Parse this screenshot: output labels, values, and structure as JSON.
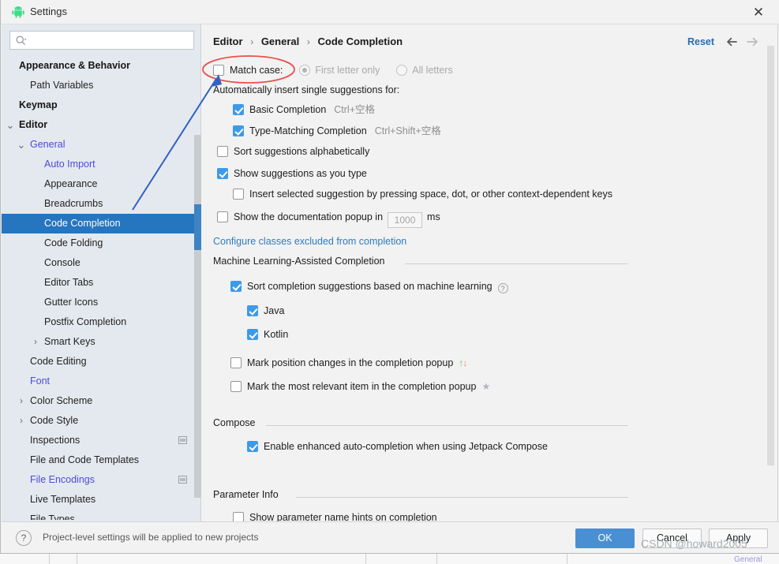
{
  "window": {
    "title": "Settings",
    "app_icon": "android-robot-icon",
    "close_label": "✕"
  },
  "sidebar": {
    "search": {
      "placeholder": "",
      "value": "",
      "icon": "search-icon"
    },
    "items": [
      {
        "label": "Appearance & Behavior",
        "indent": 0,
        "style": "bold",
        "arrow": "",
        "badge": false
      },
      {
        "label": "Path Variables",
        "indent": 14,
        "style": "plain",
        "arrow": "",
        "badge": false
      },
      {
        "label": "Keymap",
        "indent": 0,
        "style": "bold",
        "arrow": "",
        "badge": false
      },
      {
        "label": "Editor",
        "indent": 0,
        "style": "bold",
        "arrow": "down",
        "badge": false
      },
      {
        "label": "General",
        "indent": 14,
        "style": "link",
        "arrow": "down",
        "badge": false
      },
      {
        "label": "Auto Import",
        "indent": 32,
        "style": "link",
        "arrow": "",
        "badge": false
      },
      {
        "label": "Appearance",
        "indent": 32,
        "style": "plain",
        "arrow": "",
        "badge": false
      },
      {
        "label": "Breadcrumbs",
        "indent": 32,
        "style": "plain",
        "arrow": "",
        "badge": false
      },
      {
        "label": "Code Completion",
        "indent": 32,
        "style": "selected",
        "arrow": "",
        "badge": false
      },
      {
        "label": "Code Folding",
        "indent": 32,
        "style": "plain",
        "arrow": "",
        "badge": false
      },
      {
        "label": "Console",
        "indent": 32,
        "style": "plain",
        "arrow": "",
        "badge": false
      },
      {
        "label": "Editor Tabs",
        "indent": 32,
        "style": "plain",
        "arrow": "",
        "badge": false
      },
      {
        "label": "Gutter Icons",
        "indent": 32,
        "style": "plain",
        "arrow": "",
        "badge": false
      },
      {
        "label": "Postfix Completion",
        "indent": 32,
        "style": "plain",
        "arrow": "",
        "badge": false
      },
      {
        "label": "Smart Keys",
        "indent": 32,
        "style": "plain",
        "arrow": "right",
        "badge": false
      },
      {
        "label": "Code Editing",
        "indent": 14,
        "style": "plain",
        "arrow": "",
        "badge": false
      },
      {
        "label": "Font",
        "indent": 14,
        "style": "link",
        "arrow": "",
        "badge": false
      },
      {
        "label": "Color Scheme",
        "indent": 14,
        "style": "plain",
        "arrow": "right",
        "badge": false
      },
      {
        "label": "Code Style",
        "indent": 14,
        "style": "plain",
        "arrow": "right",
        "badge": false
      },
      {
        "label": "Inspections",
        "indent": 14,
        "style": "plain",
        "arrow": "",
        "badge": true
      },
      {
        "label": "File and Code Templates",
        "indent": 14,
        "style": "plain",
        "arrow": "",
        "badge": false
      },
      {
        "label": "File Encodings",
        "indent": 14,
        "style": "link",
        "arrow": "",
        "badge": true
      },
      {
        "label": "Live Templates",
        "indent": 14,
        "style": "plain",
        "arrow": "",
        "badge": false
      },
      {
        "label": "File Types",
        "indent": 14,
        "style": "plain",
        "arrow": "",
        "badge": false
      }
    ]
  },
  "header": {
    "breadcrumb": [
      "Editor",
      "General",
      "Code Completion"
    ],
    "separator": "›",
    "reset_label": "Reset",
    "back_icon": "arrow-left-icon",
    "forward_icon": "arrow-right-icon"
  },
  "main": {
    "match_case": {
      "label": "Match case:",
      "checked": false
    },
    "case_mode": {
      "options": [
        "First letter only",
        "All letters"
      ],
      "selected": "First letter only",
      "disabled": true
    },
    "auto_insert_label": "Automatically insert single suggestions for:",
    "auto_insert_items": [
      {
        "label": "Basic Completion",
        "shortcut": "Ctrl+空格",
        "checked": true
      },
      {
        "label": "Type-Matching Completion",
        "shortcut": "Ctrl+Shift+空格",
        "checked": true
      }
    ],
    "sort_alpha": {
      "label": "Sort suggestions alphabetically",
      "checked": false
    },
    "show_as_you_type": {
      "label": "Show suggestions as you type",
      "checked": true
    },
    "insert_selected": {
      "label": "Insert selected suggestion by pressing space, dot, or other context-dependent keys",
      "checked": false
    },
    "doc_popup": {
      "label": "Show the documentation popup in",
      "checked": false,
      "value": "1000",
      "unit": "ms"
    },
    "configure_link": "Configure classes excluded from completion",
    "ml_section": {
      "title": "Machine Learning-Assisted Completion",
      "sort_ml": {
        "label": "Sort completion suggestions based on machine learning",
        "checked": true,
        "help": "?"
      },
      "languages": [
        {
          "label": "Java",
          "checked": true
        },
        {
          "label": "Kotlin",
          "checked": true
        }
      ],
      "mark_position": {
        "label": "Mark position changes in the completion popup",
        "checked": false,
        "icon": "up-down-arrows-icon"
      },
      "mark_relevant": {
        "label": "Mark the most relevant item in the completion popup",
        "checked": false,
        "icon": "star-icon"
      }
    },
    "compose_section": {
      "title": "Compose",
      "enable_compose": {
        "label": "Enable enhanced auto-completion when using Jetpack Compose",
        "checked": true
      }
    },
    "param_section": {
      "title": "Parameter Info",
      "show_hints": {
        "label": "Show parameter name hints on completion",
        "checked": false
      }
    }
  },
  "footer": {
    "help_icon": "?",
    "note": "Project-level settings will be applied to new projects",
    "ok_label": "OK",
    "cancel_label": "Cancel",
    "apply_label": "Apply"
  },
  "annotations": {
    "watermark": "CSDN @howard2005",
    "ellipse_color": "#e8504f",
    "arrow_color": "#2f62c4"
  },
  "behind": {
    "tab_label": "General"
  }
}
